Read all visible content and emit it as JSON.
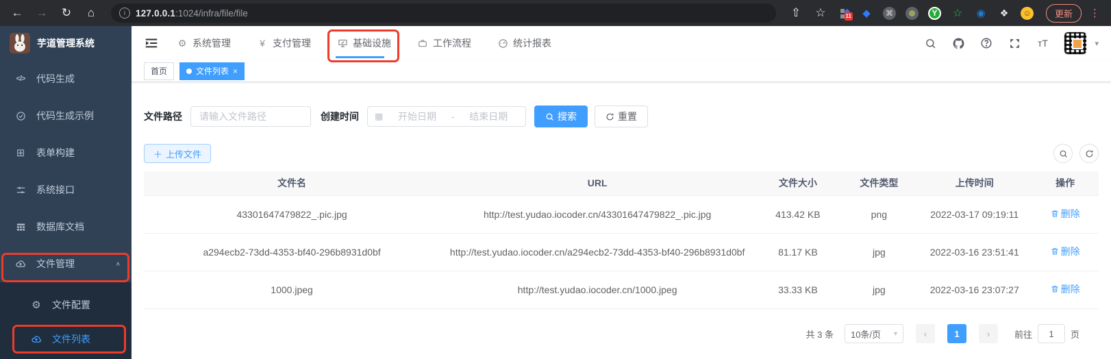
{
  "browser": {
    "url_host": "127.0.0.1",
    "url_path": ":1024/infra/file/file",
    "update_label": "更新",
    "extension_badge_count": "11"
  },
  "sidebar": {
    "app_title": "芋道管理系统",
    "items": [
      {
        "label": "代码生成"
      },
      {
        "label": "代码生成示例"
      },
      {
        "label": "表单构建"
      },
      {
        "label": "系统接口"
      },
      {
        "label": "数据库文档"
      },
      {
        "label": "文件管理"
      }
    ],
    "file_children": [
      {
        "label": "文件配置"
      },
      {
        "label": "文件列表"
      }
    ]
  },
  "topnav": {
    "tabs": [
      {
        "label": "系统管理"
      },
      {
        "label": "支付管理"
      },
      {
        "label": "基础设施"
      },
      {
        "label": "工作流程"
      },
      {
        "label": "统计报表"
      }
    ],
    "active_tab": "基础设施"
  },
  "tags": {
    "home": "首页",
    "active": "文件列表"
  },
  "filters": {
    "path_label": "文件路径",
    "path_placeholder": "请输入文件路径",
    "time_label": "创建时间",
    "start_placeholder": "开始日期",
    "range_separator": "-",
    "end_placeholder": "结束日期",
    "search_label": "搜索",
    "reset_label": "重置"
  },
  "toolbar": {
    "upload_label": "上传文件"
  },
  "table": {
    "headers": {
      "name": "文件名",
      "url": "URL",
      "size": "文件大小",
      "type": "文件类型",
      "time": "上传时间",
      "action": "操作"
    },
    "rows": [
      {
        "name": "43301647479822_.pic.jpg",
        "url": "http://test.yudao.iocoder.cn/43301647479822_.pic.jpg",
        "size": "413.42 KB",
        "type": "png",
        "time": "2022-03-17 09:19:11",
        "action": "删除"
      },
      {
        "name": "a294ecb2-73dd-4353-bf40-296b8931d0bf",
        "url": "http://test.yudao.iocoder.cn/a294ecb2-73dd-4353-bf40-296b8931d0bf",
        "size": "81.17 KB",
        "type": "jpg",
        "time": "2022-03-16 23:51:41",
        "action": "删除"
      },
      {
        "name": "1000.jpeg",
        "url": "http://test.yudao.iocoder.cn/1000.jpeg",
        "size": "33.33 KB",
        "type": "jpg",
        "time": "2022-03-16 23:07:27",
        "action": "删除"
      }
    ]
  },
  "pagination": {
    "total": "共 3 条",
    "page_size": "10条/页",
    "prev": "‹",
    "current_page": "1",
    "next": "›",
    "goto_label": "前往",
    "goto_value": "1",
    "page_unit": "页"
  },
  "icons": {
    "yen": "¥",
    "gear": "⚙",
    "diamond": "◆",
    "command": "⌘",
    "letter_y": "Y",
    "star_outline": "☆",
    "eye": "◉",
    "puzzle": "❖",
    "smile": "☺",
    "share": "⇧",
    "bookmark_star": "☆",
    "back": "←",
    "forward": "→",
    "reload": "↻",
    "home": "⌂",
    "info": "i",
    "kebab": "⋮",
    "chevron_up": "∧",
    "caret_down": "▾",
    "select_caret": "▾",
    "calendar": "▦",
    "plus": "＋",
    "close": "×",
    "font_size": "тT",
    "grid": "⊞",
    "db_table": "▦",
    "cloud": "☁",
    "code": "</>"
  },
  "colors": {
    "accent": "#409eff",
    "sidebar_bg": "#304156",
    "submenu_bg": "#1f2d3d",
    "annotation_red": "#ee3b2a",
    "update_warning": "#f28b82"
  }
}
